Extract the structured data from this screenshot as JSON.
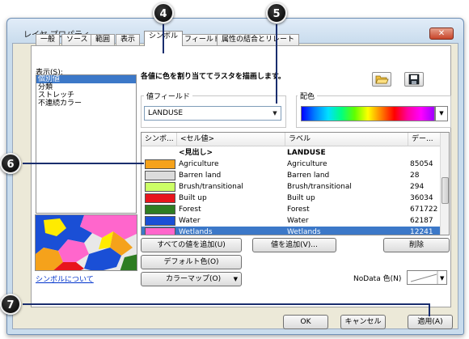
{
  "window": {
    "title": "レイヤ プロパティ",
    "close_symbol": "✕"
  },
  "tabs": [
    "一般",
    "ソース",
    "範囲",
    "表示",
    "シンボル",
    "フィールド",
    "属性の結合とリレート"
  ],
  "active_tab": "シンボル",
  "left_panel": {
    "show_label": "表示(S):",
    "items": [
      "個別値",
      "分類",
      "ストレッチ",
      "不連続カラー"
    ],
    "selected_index": 0,
    "help_link": "シンボルについて"
  },
  "right_panel": {
    "heading": "各値に色を割り当ててラスタを描画します。",
    "value_field_label": "値フィールド",
    "value_field_value": "LANDUSE",
    "color_scheme_label": "配色",
    "icons": [
      "open-folder-icon",
      "save-icon"
    ]
  },
  "table": {
    "columns": [
      "シンボ...",
      "<セル値>",
      "ラベル",
      "デー..."
    ],
    "header_row": {
      "value": "<見出し>",
      "label": "LANDUSE"
    },
    "rows": [
      {
        "color": "#f5a21b",
        "value": "Agriculture",
        "label": "Agriculture",
        "count": "85054"
      },
      {
        "color": "#dcdcdc",
        "value": "Barren land",
        "label": "Barren land",
        "count": "28"
      },
      {
        "color": "#ccff66",
        "value": "Brush/transitional",
        "label": "Brush/transitional",
        "count": "294"
      },
      {
        "color": "#e8141c",
        "value": "Built up",
        "label": "Built up",
        "count": "36034"
      },
      {
        "color": "#2e7d22",
        "value": "Forest",
        "label": "Forest",
        "count": "671722"
      },
      {
        "color": "#1a4fd6",
        "value": "Water",
        "label": "Water",
        "count": "62187"
      },
      {
        "color": "#ff66cc",
        "value": "Wetlands",
        "label": "Wetlands",
        "count": "12241"
      }
    ],
    "selected_row": 6
  },
  "buttons": {
    "add_all": "すべての値を追加(U)",
    "add_values": "値を追加(V)...",
    "remove": "削除",
    "default_colors": "デフォルト色(O)",
    "color_map": "カラーマップ(O)",
    "nodata_label": "NoData 色(N)"
  },
  "footer": {
    "ok": "OK",
    "cancel": "キャンセル",
    "apply": "適用(A)"
  },
  "callouts": [
    "4",
    "5",
    "6",
    "7"
  ]
}
